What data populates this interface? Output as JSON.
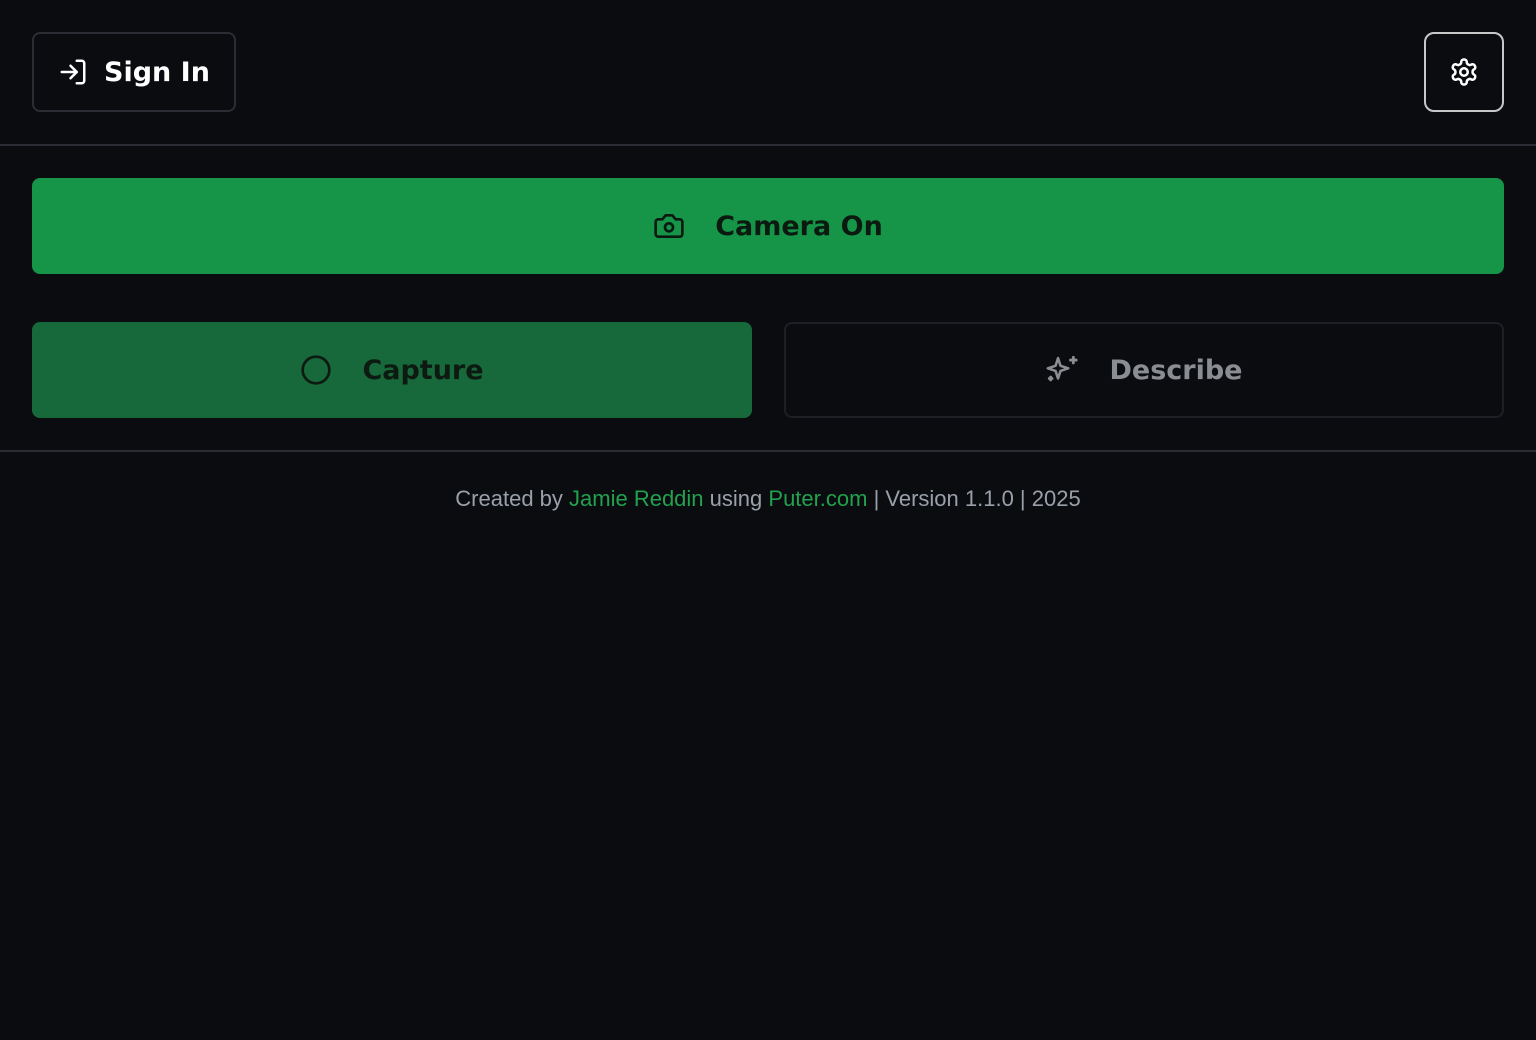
{
  "header": {
    "signin_label": "Sign In",
    "signin_icon": "sign-in-icon",
    "settings_icon": "gear-icon"
  },
  "actions": {
    "camera_label": "Camera On",
    "camera_icon": "camera-icon",
    "capture_label": "Capture",
    "capture_icon": "circle-icon",
    "describe_label": "Describe",
    "describe_icon": "sparkles-icon"
  },
  "footer": {
    "prefix": "Created by",
    "author": "Jamie Reddin",
    "middle": "using",
    "platform": "Puter.com",
    "suffix": "| Version 1.1.0 | 2025"
  },
  "colors": {
    "background": "#0b0c0f",
    "accent": "#169447",
    "accent_dark": "#17683a",
    "link": "#22a14f",
    "border": "#2a2d33"
  }
}
